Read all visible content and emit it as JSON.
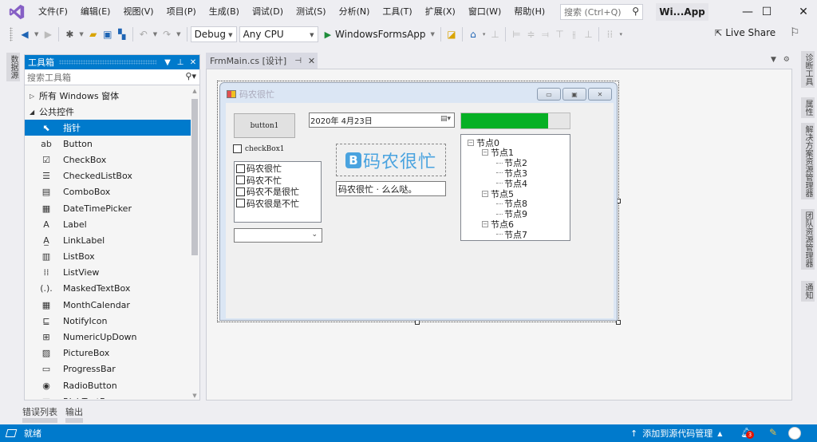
{
  "menubar": {
    "items": [
      "文件(F)",
      "编辑(E)",
      "视图(V)",
      "项目(P)",
      "生成(B)",
      "调试(D)",
      "测试(S)",
      "分析(N)",
      "工具(T)",
      "扩展(X)",
      "窗口(W)",
      "帮助(H)"
    ],
    "search_placeholder": "搜索 (Ctrl+Q)",
    "title_badge": "Wi...App",
    "window_controls": {
      "minimize": "—",
      "maximize": "☐",
      "close": "✕"
    }
  },
  "toolbar": {
    "config": "Debug",
    "platform": "Any CPU",
    "run_target": "WindowsFormsApp",
    "live_share": "Live Share"
  },
  "left_strip": {
    "tabs": [
      "数据源"
    ]
  },
  "toolbox": {
    "title": "工具箱",
    "search_placeholder": "搜索工具箱",
    "groups": [
      {
        "label": "所有 Windows 窗体",
        "expanded": false
      },
      {
        "label": "公共控件",
        "expanded": true
      }
    ],
    "items": [
      {
        "label": "指针",
        "icon": "pointer-icon",
        "glyph": "⬉",
        "selected": true
      },
      {
        "label": "Button",
        "icon": "button-icon",
        "glyph": "ab"
      },
      {
        "label": "CheckBox",
        "icon": "checkbox-icon",
        "glyph": "☑"
      },
      {
        "label": "CheckedListBox",
        "icon": "checkedlistbox-icon",
        "glyph": "☰"
      },
      {
        "label": "ComboBox",
        "icon": "combobox-icon",
        "glyph": "▤"
      },
      {
        "label": "DateTimePicker",
        "icon": "datetimepicker-icon",
        "glyph": "▦"
      },
      {
        "label": "Label",
        "icon": "label-icon",
        "glyph": "A"
      },
      {
        "label": "LinkLabel",
        "icon": "linklabel-icon",
        "glyph": "A̲"
      },
      {
        "label": "ListBox",
        "icon": "listbox-icon",
        "glyph": "▥"
      },
      {
        "label": "ListView",
        "icon": "listview-icon",
        "glyph": "⁞⁞"
      },
      {
        "label": "MaskedTextBox",
        "icon": "maskedtextbox-icon",
        "glyph": "(.)."
      },
      {
        "label": "MonthCalendar",
        "icon": "monthcalendar-icon",
        "glyph": "▦"
      },
      {
        "label": "NotifyIcon",
        "icon": "notifyicon-icon",
        "glyph": "⊑"
      },
      {
        "label": "NumericUpDown",
        "icon": "numericupdown-icon",
        "glyph": "⊞"
      },
      {
        "label": "PictureBox",
        "icon": "picturebox-icon",
        "glyph": "▨"
      },
      {
        "label": "ProgressBar",
        "icon": "progressbar-icon",
        "glyph": "▭"
      },
      {
        "label": "RadioButton",
        "icon": "radiobutton-icon",
        "glyph": "◉"
      },
      {
        "label": "RichTextBox",
        "icon": "richtextbox-icon",
        "glyph": "▤"
      }
    ]
  },
  "bottom_tabs": [
    "错误列表",
    "输出"
  ],
  "document": {
    "tab_label": "FrmMain.cs [设计]"
  },
  "right_strip": {
    "tabs": [
      "诊断工具",
      "属性",
      "解决方案资源管理器",
      "团队资源管理器",
      "通知"
    ]
  },
  "form": {
    "title": "码农很忙",
    "button_text": "button1",
    "checkbox_text": "checkBox1",
    "checked_list_items": [
      "码农很忙",
      "码农不忙",
      "码农不是很忙",
      "码农很是不忙"
    ],
    "combo_value": "",
    "date_value": "2020年  4月23日",
    "progress_value": 0.8,
    "picture_logo_letter": "B",
    "picture_logo_text": "码农很忙",
    "textbox_value": "码农很忙 · 么么哒。",
    "tree": [
      {
        "label": "节点0",
        "level": 0,
        "expander": "⊟"
      },
      {
        "label": "节点1",
        "level": 1,
        "expander": "⊟"
      },
      {
        "label": "节点2",
        "level": 2
      },
      {
        "label": "节点3",
        "level": 2
      },
      {
        "label": "节点4",
        "level": 2
      },
      {
        "label": "节点5",
        "level": 1,
        "expander": "⊟"
      },
      {
        "label": "节点8",
        "level": 2
      },
      {
        "label": "节点9",
        "level": 2
      },
      {
        "label": "节点6",
        "level": 1,
        "expander": "⊟"
      },
      {
        "label": "节点7",
        "level": 2
      }
    ]
  },
  "statusbar": {
    "status": "就绪",
    "source_control": "添加到源代码管理",
    "notification_count": "3"
  }
}
